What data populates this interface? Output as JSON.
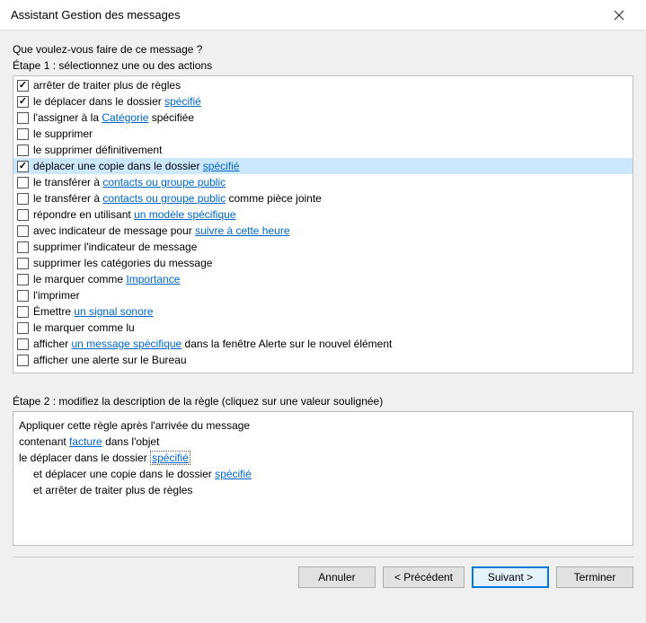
{
  "window": {
    "title": "Assistant Gestion des messages"
  },
  "question": "Que voulez-vous faire de ce message ?",
  "step1_label": "Étape 1 : sélectionnez une ou des actions",
  "step2_label": "Étape 2 : modifiez la description de la règle (cliquez sur une valeur soulignée)",
  "actions": [
    {
      "checked": true,
      "selected": false,
      "pre": "arrêter de traiter plus de règles",
      "link": "",
      "post": ""
    },
    {
      "checked": true,
      "selected": false,
      "pre": "le déplacer dans le dossier ",
      "link": "spécifié",
      "post": ""
    },
    {
      "checked": false,
      "selected": false,
      "pre": "l'assigner à la ",
      "link": "Catégorie",
      "post": " spécifiée"
    },
    {
      "checked": false,
      "selected": false,
      "pre": "le supprimer",
      "link": "",
      "post": ""
    },
    {
      "checked": false,
      "selected": false,
      "pre": "le supprimer définitivement",
      "link": "",
      "post": ""
    },
    {
      "checked": true,
      "selected": true,
      "pre": "déplacer une copie dans le dossier ",
      "link": "spécifié",
      "post": ""
    },
    {
      "checked": false,
      "selected": false,
      "pre": "le transférer à ",
      "link": "contacts ou groupe public",
      "post": ""
    },
    {
      "checked": false,
      "selected": false,
      "pre": "le transférer à ",
      "link": "contacts ou groupe public",
      "post": " comme pièce jointe"
    },
    {
      "checked": false,
      "selected": false,
      "pre": "répondre en utilisant ",
      "link": "un modèle spécifique",
      "post": ""
    },
    {
      "checked": false,
      "selected": false,
      "pre": "avec indicateur de message pour ",
      "link": "suivre à cette heure",
      "post": ""
    },
    {
      "checked": false,
      "selected": false,
      "pre": "supprimer l'indicateur de message",
      "link": "",
      "post": ""
    },
    {
      "checked": false,
      "selected": false,
      "pre": "supprimer les catégories du message",
      "link": "",
      "post": ""
    },
    {
      "checked": false,
      "selected": false,
      "pre": "le marquer comme ",
      "link": "Importance",
      "post": ""
    },
    {
      "checked": false,
      "selected": false,
      "pre": "l'imprimer",
      "link": "",
      "post": ""
    },
    {
      "checked": false,
      "selected": false,
      "pre": "Émettre ",
      "link": "un signal sonore",
      "post": ""
    },
    {
      "checked": false,
      "selected": false,
      "pre": "le marquer comme lu",
      "link": "",
      "post": ""
    },
    {
      "checked": false,
      "selected": false,
      "pre": "afficher ",
      "link": "un message spécifique",
      "post": " dans la fenêtre Alerte sur le nouvel élément"
    },
    {
      "checked": false,
      "selected": false,
      "pre": "afficher une alerte sur le Bureau",
      "link": "",
      "post": ""
    }
  ],
  "description": {
    "l1_pre": "Appliquer cette règle après l'arrivée du message",
    "l2_pre": "contenant ",
    "l2_link": "facture",
    "l2_post": " dans l'objet",
    "l3_pre": "le déplacer dans le dossier ",
    "l3_link": "spécifié",
    "l4_pre": "et déplacer une copie dans le dossier ",
    "l4_link": "spécifié",
    "l5_pre": "et arrêter de traiter plus de règles"
  },
  "buttons": {
    "cancel": "Annuler",
    "back": "< Précédent",
    "next": "Suivant >",
    "finish": "Terminer"
  }
}
